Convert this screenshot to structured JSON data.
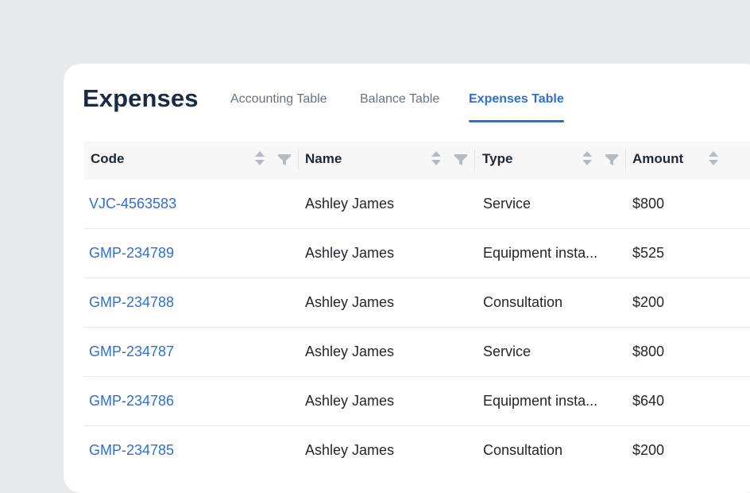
{
  "page": {
    "title": "Expenses"
  },
  "tabs": [
    {
      "label": "Accounting Table",
      "active": false
    },
    {
      "label": "Balance Table",
      "active": false
    },
    {
      "label": "Expenses Table",
      "active": true
    }
  ],
  "table": {
    "columns": [
      "Code",
      "Name",
      "Type",
      "Amount"
    ],
    "rows": [
      {
        "code": "VJC-4563583",
        "name": "Ashley James",
        "type": "Service",
        "amount": "$800"
      },
      {
        "code": "GMP-234789",
        "name": "Ashley James",
        "type": "Equipment insta...",
        "amount": "$525"
      },
      {
        "code": "GMP-234788",
        "name": "Ashley James",
        "type": "Consultation",
        "amount": "$200"
      },
      {
        "code": "GMP-234787",
        "name": "Ashley James",
        "type": "Service",
        "amount": "$800"
      },
      {
        "code": "GMP-234786",
        "name": "Ashley James",
        "type": "Equipment insta...",
        "amount": "$640"
      },
      {
        "code": "GMP-234785",
        "name": "Ashley James",
        "type": "Consultation",
        "amount": "$200"
      }
    ]
  },
  "icons": {
    "sort": "sort-icon",
    "filter": "filter-icon"
  },
  "colors": {
    "accent": "#2f6fd1",
    "title": "#1c2b44",
    "background": "#e8e9ed",
    "header_bg": "#f7f7f8"
  }
}
